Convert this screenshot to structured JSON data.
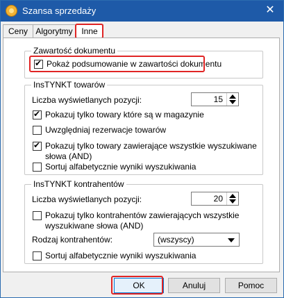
{
  "window": {
    "title": "Szansa sprzedaży",
    "close_glyph": "✕"
  },
  "tabs": [
    {
      "label": "Ceny",
      "active": false
    },
    {
      "label": "Algorytmy",
      "active": false
    },
    {
      "label": "Inne",
      "active": true
    }
  ],
  "doc_group": {
    "legend": "Zawartość dokumentu",
    "show_summary": {
      "label": "Pokaż podsumowanie w zawartości dokumentu",
      "checked": true
    }
  },
  "products_group": {
    "legend": "InsTYNKT towarów",
    "count_label": "Liczba wyświetlanych pozycji:",
    "count_value": "15",
    "only_in_stock": {
      "label": "Pokazuj tylko towary które są w magazynie",
      "checked": true
    },
    "include_reservations": {
      "label": "Uwzględniaj rezerwacje towarów",
      "checked": false
    },
    "all_words_line1": "Pokazuj tylko towary zawierające wszystkie wyszukiwane",
    "all_words_line2": "słowa (AND)",
    "all_words_checked": true,
    "sort_alpha": {
      "label": "Sortuj alfabetycznie wyniki wyszukiwania",
      "checked": false
    }
  },
  "contractors_group": {
    "legend": "InsTYNKT kontrahentów",
    "count_label": "Liczba wyświetlanych pozycji:",
    "count_value": "20",
    "all_words_line1": "Pokazuj tylko kontrahentów zawierających wszystkie",
    "all_words_line2": "wyszukiwane słowa (AND)",
    "all_words_checked": false,
    "type_label": "Rodzaj kontrahentów:",
    "type_value": "(wszyscy)",
    "sort_alpha": {
      "label": "Sortuj alfabetycznie wyniki wyszukiwania",
      "checked": false
    }
  },
  "buttons": {
    "ok": "OK",
    "cancel": "Anuluj",
    "help": "Pomoc"
  },
  "colors": {
    "titlebar": "#1e5aa8",
    "highlight": "#e02424"
  }
}
